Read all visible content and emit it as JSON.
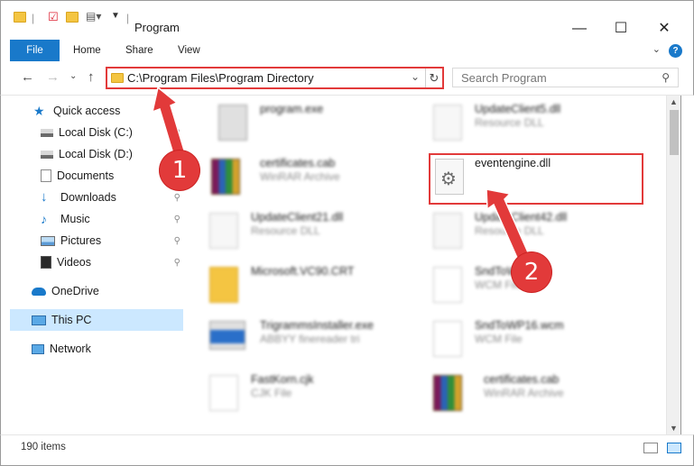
{
  "window": {
    "title": "Program",
    "minimize": "—",
    "maximize": "☐",
    "close": "✕"
  },
  "ribbon": {
    "tabs": [
      "File",
      "Home",
      "Share",
      "View"
    ],
    "help": "?"
  },
  "address": {
    "path": "C:\\Program Files\\Program Directory",
    "search_placeholder": "Search Program"
  },
  "sidebar": {
    "items": [
      {
        "label": "Quick access",
        "icon": "star-icon",
        "pinned": false
      },
      {
        "label": "Local Disk (C:)",
        "icon": "drive-icon",
        "pinned": true
      },
      {
        "label": "Local Disk (D:)",
        "icon": "drive-icon",
        "pinned": false
      },
      {
        "label": "Documents",
        "icon": "documents-icon",
        "pinned": true
      },
      {
        "label": "Downloads",
        "icon": "download-icon",
        "pinned": true
      },
      {
        "label": "Music",
        "icon": "music-icon",
        "pinned": true
      },
      {
        "label": "Pictures",
        "icon": "pictures-icon",
        "pinned": true
      },
      {
        "label": "Videos",
        "icon": "videos-icon",
        "pinned": true
      },
      {
        "label": "OneDrive",
        "icon": "onedrive-icon",
        "pinned": false
      },
      {
        "label": "This PC",
        "icon": "pc-icon",
        "pinned": false,
        "selected": true
      },
      {
        "label": "Network",
        "icon": "network-icon",
        "pinned": false
      }
    ]
  },
  "files": {
    "left": [
      {
        "name": "program.exe",
        "type": "",
        "icon": "exe-icon"
      },
      {
        "name": "certificates.cab",
        "type": "WinRAR Archive",
        "icon": "winrar-icon"
      },
      {
        "name": "UpdateClient21.dll",
        "type": "Resource DLL",
        "icon": "dll-icon"
      },
      {
        "name": "Microsoft.VC90.CRT",
        "type": "",
        "icon": "folder-icon"
      },
      {
        "name": "TrigrammsInstaller.exe",
        "type": "ABBYY finereader tri",
        "icon": "installer-icon"
      },
      {
        "name": "FastKorn.cjk",
        "type": "CJK File",
        "icon": "file-icon"
      }
    ],
    "right": [
      {
        "name": "UpdateClient5.dll",
        "type": "Resource DLL",
        "icon": "dll-icon"
      },
      {
        "name": "eventengine.dll",
        "type": "",
        "icon": "dll-gear-icon"
      },
      {
        "name": "UpdateClient42.dll",
        "type": "Resource DLL",
        "icon": "dll-icon"
      },
      {
        "name": "SndToWP.wcm",
        "type": "WCM File",
        "icon": "file-icon"
      },
      {
        "name": "SndToWP16.wcm",
        "type": "WCM File",
        "icon": "file-icon"
      },
      {
        "name": "certificates.cab",
        "type": "WinRAR Archive",
        "icon": "winrar-icon"
      }
    ]
  },
  "status": {
    "count": "190 items"
  },
  "annotations": {
    "step1": "1",
    "step2": "2",
    "color": "#e23a3a"
  }
}
